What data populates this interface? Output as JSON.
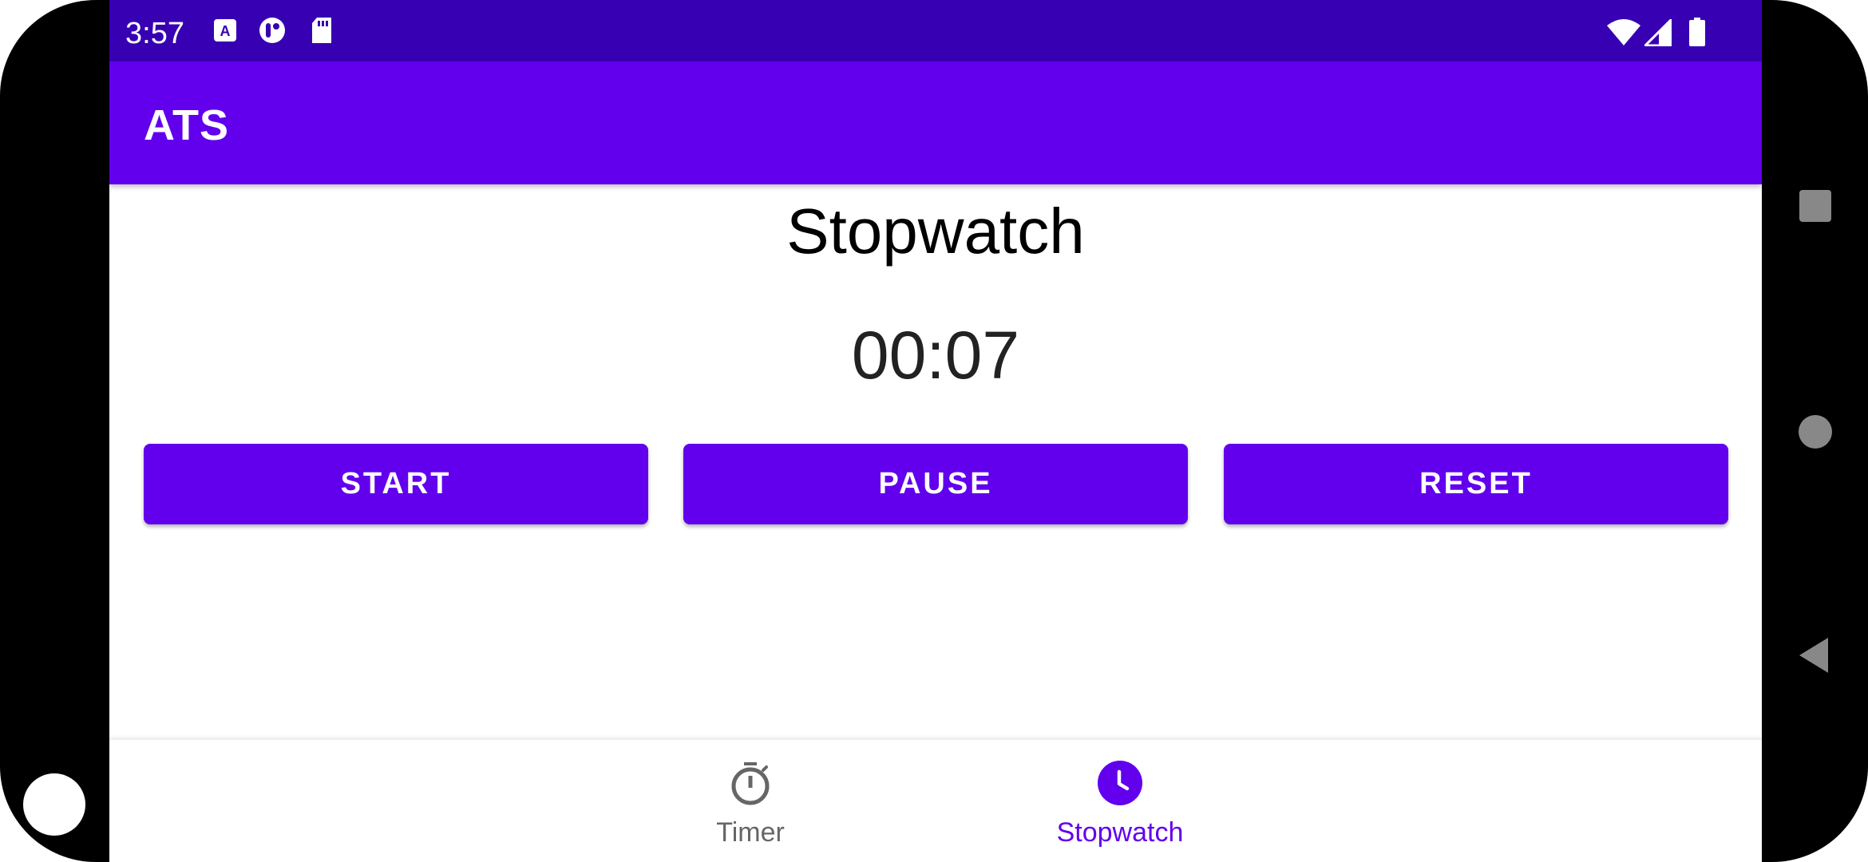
{
  "status_bar": {
    "time": "3:57",
    "left_icons": [
      "keyboard-a-icon",
      "media-icon",
      "sd-card-icon"
    ],
    "right_icons": [
      "wifi-icon",
      "signal-icon",
      "battery-icon"
    ]
  },
  "app_bar": {
    "title": "ATS"
  },
  "main": {
    "title": "Stopwatch",
    "elapsed": "00:07",
    "buttons": {
      "start": "START",
      "pause": "PAUSE",
      "reset": "RESET"
    }
  },
  "bottom_nav": {
    "items": [
      {
        "label": "Timer",
        "icon": "timer-icon",
        "selected": false
      },
      {
        "label": "Stopwatch",
        "icon": "clock-icon",
        "selected": true
      }
    ]
  },
  "system_nav": [
    "recents-icon",
    "home-icon",
    "back-icon"
  ],
  "colors": {
    "primary": "#6200ee",
    "primary_dark": "#3700b3",
    "nav_inactive": "#666666"
  }
}
